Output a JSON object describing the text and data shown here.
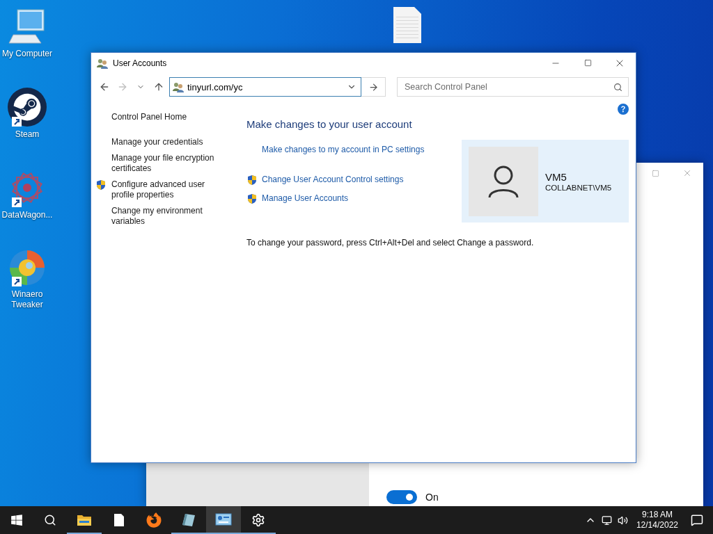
{
  "desktop_icons": [
    {
      "label": "My Computer",
      "kind": "computer",
      "shortcut": false
    },
    {
      "label": "Steam",
      "kind": "steam",
      "shortcut": true
    },
    {
      "label": "DataWagon...",
      "kind": "datawagon",
      "shortcut": true
    },
    {
      "label": "Winaero Tweaker",
      "kind": "winaero",
      "shortcut": true
    }
  ],
  "settings_window": {
    "toggle": {
      "on": true,
      "label": "On"
    }
  },
  "main_window": {
    "title": "User Accounts",
    "address": "tinyurl.com/yc",
    "search_placeholder": "Search Control Panel",
    "forward_disabled": true,
    "sidebar": [
      {
        "label": "Control Panel Home",
        "kind": "home"
      },
      {
        "label": "Manage your credentials",
        "kind": "link"
      },
      {
        "label": "Manage your file encryption certificates",
        "kind": "link"
      },
      {
        "label": "Configure advanced user profile properties",
        "kind": "shield"
      },
      {
        "label": "Change my environment variables",
        "kind": "link"
      }
    ],
    "heading": "Make changes to your user account",
    "tasks": [
      {
        "label": "Make changes to my account in PC settings",
        "shield": false
      },
      {
        "label": "Change User Account Control settings",
        "shield": true
      },
      {
        "label": "Manage User Accounts",
        "shield": true
      }
    ],
    "account": {
      "name": "VM5",
      "domain": "COLLABNET\\VM5"
    },
    "note": "To change your password, press Ctrl+Alt+Del and select Change a password."
  },
  "taskbar": {
    "apps": [
      {
        "kind": "explorer",
        "running": true,
        "active": false
      },
      {
        "kind": "notepad",
        "running": false,
        "active": false
      },
      {
        "kind": "firefox",
        "running": false,
        "active": false
      },
      {
        "kind": "notebook",
        "running": true,
        "active": false
      },
      {
        "kind": "control_panel",
        "running": true,
        "active": true
      },
      {
        "kind": "settings",
        "running": true,
        "active": false
      }
    ],
    "clock": {
      "time": "9:18 AM",
      "date": "12/14/2022"
    }
  }
}
